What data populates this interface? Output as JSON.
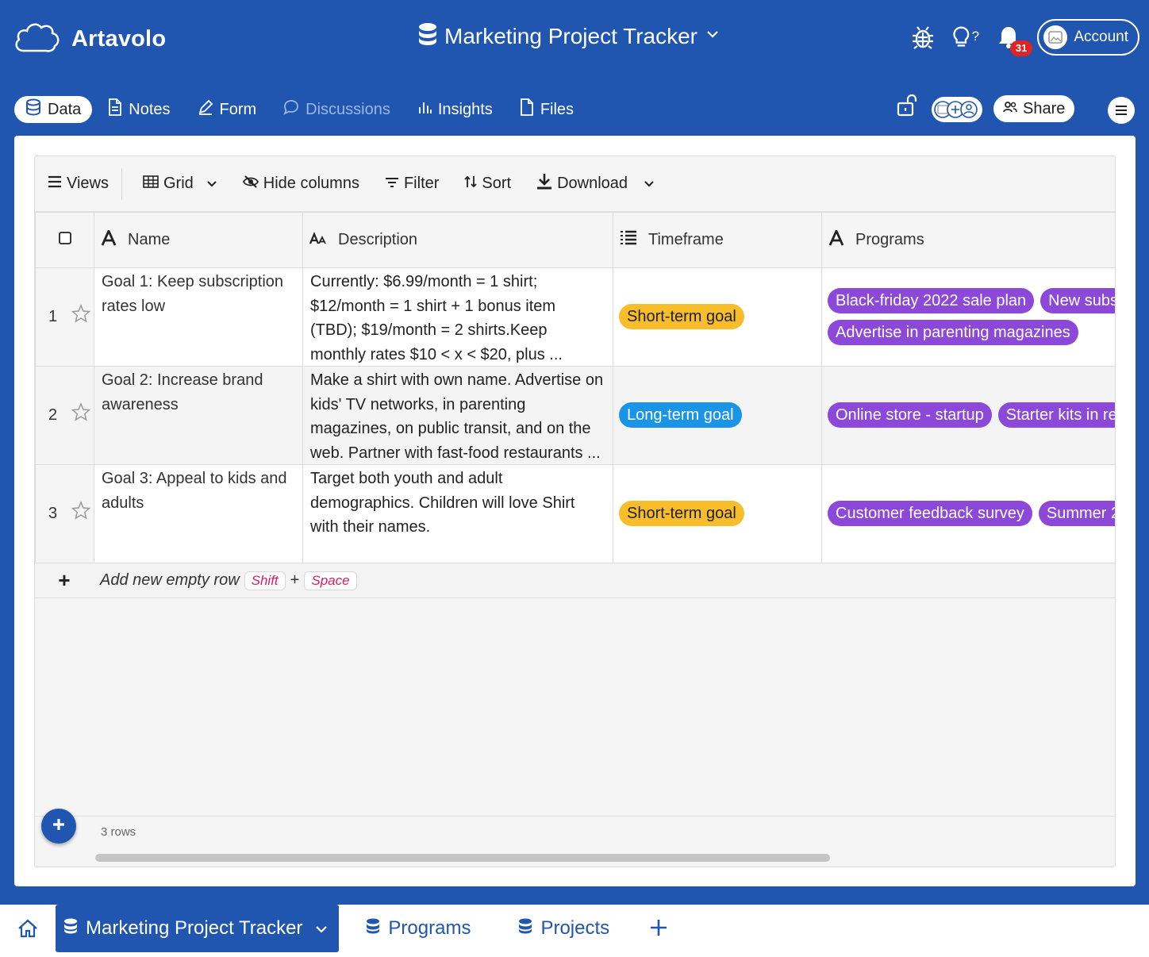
{
  "app": {
    "name": "Artavolo",
    "title": "Marketing Project Tracker",
    "notification_count": "31",
    "account_label": "Account"
  },
  "tabs": [
    {
      "label": "Data",
      "active": true
    },
    {
      "label": "Notes"
    },
    {
      "label": "Form"
    },
    {
      "label": "Discussions",
      "disabled": true
    },
    {
      "label": "Insights"
    },
    {
      "label": "Files"
    }
  ],
  "share_label": "Share",
  "toolbar": {
    "views": "Views",
    "grid": "Grid",
    "hide_columns": "Hide columns",
    "filter": "Filter",
    "sort": "Sort",
    "download": "Download"
  },
  "columns": [
    "Name",
    "Description",
    "Timeframe",
    "Programs"
  ],
  "rows": [
    {
      "num": "1",
      "name": "Goal 1: Keep subscription rates low",
      "description": "Currently: $6.99/month = 1 shirt; $12/month = 1 shirt + 1 bonus item (TBD); $19/month = 2 shirts.Keep monthly rates $10 < x < $20, plus ...",
      "timeframe": "Short-term goal",
      "programs_line1": [
        "Black-friday 2022 sale plan",
        "New subs"
      ],
      "programs_line2": [
        "Advertise in parenting magazines"
      ]
    },
    {
      "num": "2",
      "name": "Goal 2: Increase brand awareness",
      "description": "Make a shirt with own name. Advertise on kids' TV networks, in parenting magazines, on public transit, and on the web. Partner with fast-food restaurants ...",
      "timeframe": "Long-term goal",
      "programs_line1": [
        "Online store - startup",
        "Starter kits in re"
      ],
      "programs_line2": []
    },
    {
      "num": "3",
      "name": "Goal 3: Appeal to kids and adults",
      "description": "Target both youth and adult demographics. Children will love Shirt with their names.",
      "timeframe": "Short-term goal",
      "programs_line1": [
        "Customer feedback survey",
        "Summer 2"
      ],
      "programs_line2": []
    }
  ],
  "add_row": {
    "label": "Add new empty row",
    "key1": "Shift",
    "plus": "+",
    "key2": "Space"
  },
  "row_count": "3 rows",
  "bottom_tabs": [
    {
      "label": "Marketing Project Tracker",
      "active": true
    },
    {
      "label": "Programs"
    },
    {
      "label": "Projects"
    }
  ],
  "colors": {
    "brand": "#2056b0",
    "short_term": "#f7bd2a",
    "long_term": "#1a94e6",
    "program": "#8c48d8"
  }
}
